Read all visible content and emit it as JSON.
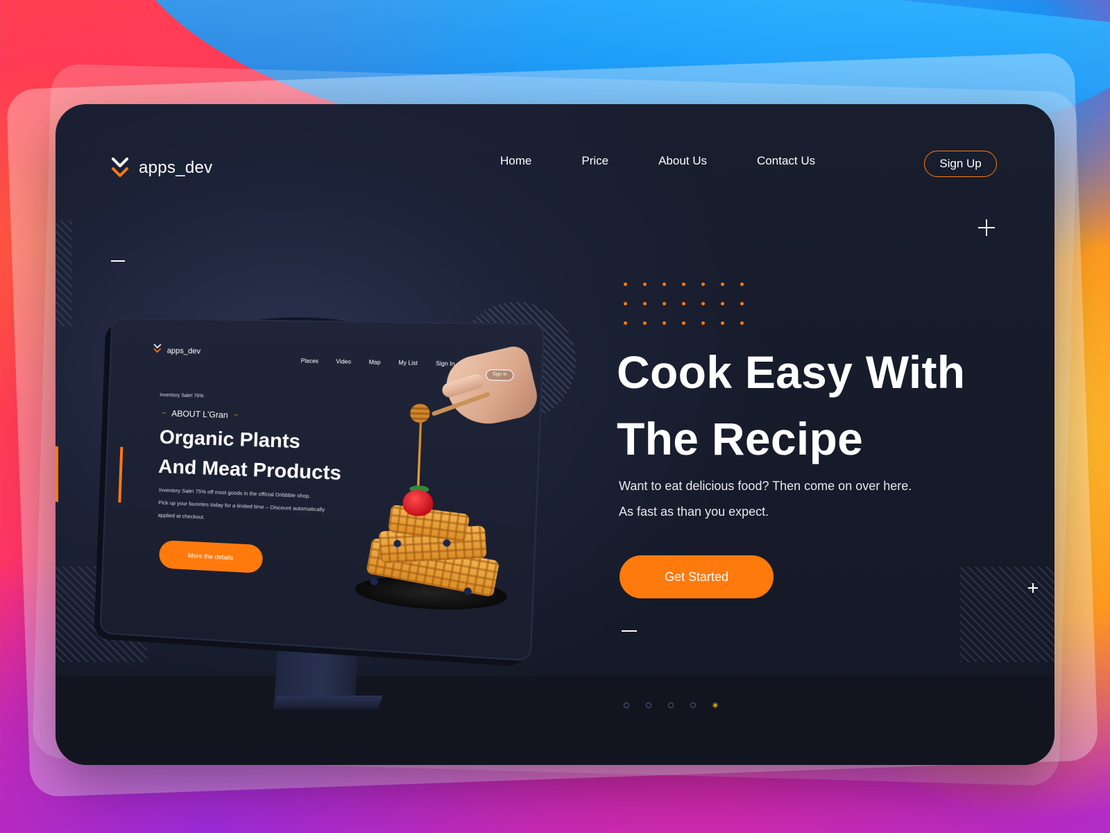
{
  "brand": {
    "name": "apps_dev",
    "accent": "#ff7a12"
  },
  "nav": {
    "items": [
      "Home",
      "Price",
      "About Us",
      "Contact Us"
    ],
    "signup_label": "Sign Up"
  },
  "hero": {
    "title_line1": "Cook Easy With",
    "title_line2": "The Recipe",
    "subtitle_line1": "Want to eat delicious food? Then come on over here.",
    "subtitle_line2": "As fast as than you expect.",
    "cta_label": "Get Started"
  },
  "pager": {
    "count": 5,
    "active_index": 4
  },
  "mockup": {
    "logo_text": "apps_dev",
    "nav_items": [
      "Places",
      "Video",
      "Map",
      "My List",
      "Sign In"
    ],
    "signin_label": "Sign In",
    "small_label": "Inventory Sale! 76%",
    "about_label": "ABOUT L'Gran",
    "title_line1": "Organic Plants",
    "title_line2": "And Meat Products",
    "body_line1": "Inventory Sale! 75% off most goods in the official Dribbble shop.",
    "body_line2": "Pick up your favorites today for a limited time – Discount automatically",
    "body_line3": "applied at checkout.",
    "button_label": "More the details"
  },
  "icons": {
    "logo": "chevron-double-down-icon",
    "plus": "plus-icon",
    "dash": "dash-icon"
  }
}
